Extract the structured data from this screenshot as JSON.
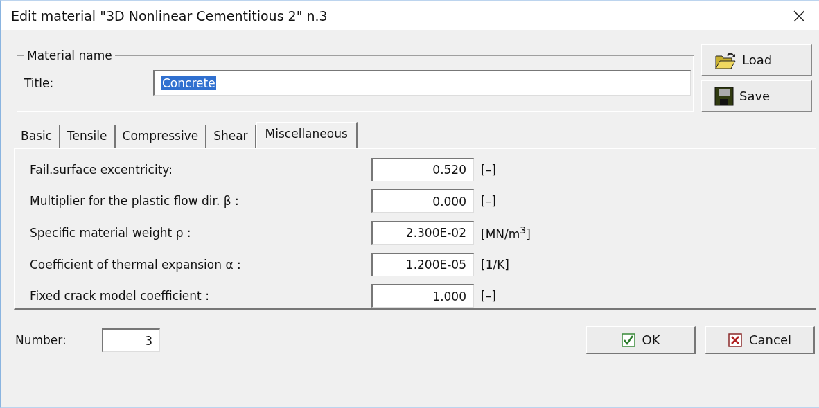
{
  "window": {
    "title": "Edit material  \"3D Nonlinear Cementitious 2\" n.3",
    "close": "×"
  },
  "material_name": {
    "legend": "Material name",
    "label": "Title:",
    "value": "Concrete",
    "text_selected": true
  },
  "side_buttons": [
    {
      "kind": "load",
      "label": "Load"
    },
    {
      "kind": "save",
      "label": "Save"
    }
  ],
  "tabs": [
    {
      "label": "Basic",
      "selected": false
    },
    {
      "label": "Tensile",
      "selected": false
    },
    {
      "label": "Compressive",
      "selected": false
    },
    {
      "label": "Shear",
      "selected": false
    },
    {
      "label": "Miscellaneous",
      "selected": true
    }
  ],
  "fields": [
    {
      "label": "Fail.surface excentricity:",
      "value": "0.520",
      "unit": "[–]"
    },
    {
      "label": "Multiplier for the plastic flow dir. β :",
      "value": "0.000",
      "unit": "[–]"
    },
    {
      "label": "Specific material weight ρ :",
      "value": "2.300E-02",
      "unit": "[MN/m$^{3}$]"
    },
    {
      "label": "Coefficient of thermal expansion α :",
      "value": "1.200E-05",
      "unit": "[1/K]"
    },
    {
      "label": "Fixed crack model coefficient :",
      "value": "1.000",
      "unit": "[–]"
    }
  ],
  "number": {
    "label": "Number:",
    "value": "3"
  },
  "buttons": [
    {
      "kind": "ok",
      "label": "OK"
    },
    {
      "kind": "cancel",
      "label": "Cancel"
    }
  ]
}
